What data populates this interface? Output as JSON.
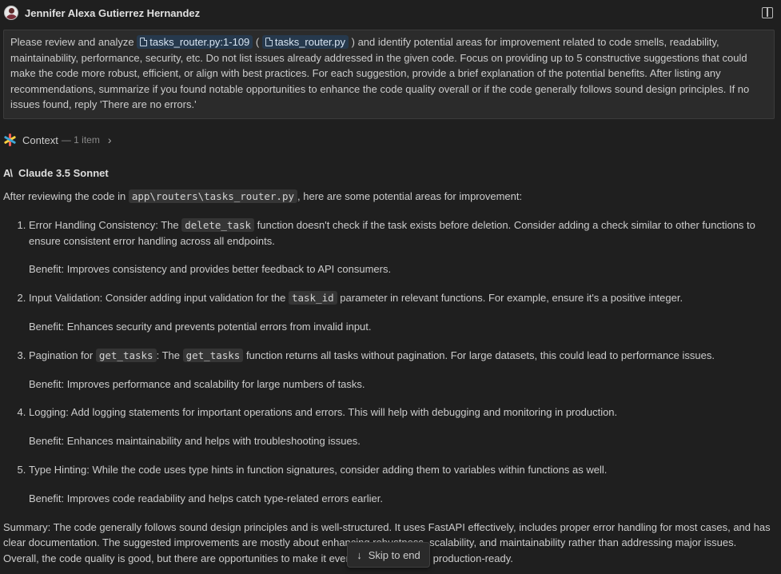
{
  "header": {
    "username": "Jennifer Alexa Gutierrez Hernandez"
  },
  "prompt": {
    "text_before": "Please review and analyze ",
    "chip1": "tasks_router.py:1-109",
    "text_mid1": " ( ",
    "chip2": "tasks_router.py",
    "text_after": " ) and identify potential areas for improvement related to code smells, readability, maintainability, performance, security, etc. Do not list issues already addressed in the given code. Focus on providing up to 5 constructive suggestions that could make the code more robust, efficient, or align with best practices. For each suggestion, provide a brief explanation of the potential benefits. After listing any recommendations, summarize if you found notable opportunities to enhance the code quality overall or if the code generally follows sound design principles. If no issues found, reply 'There are no errors.'"
  },
  "context": {
    "label": "Context",
    "count": "— 1 item"
  },
  "model": {
    "icon_text": "A\\",
    "name": "Claude 3.5 Sonnet"
  },
  "response": {
    "intro_before": "After reviewing the code in ",
    "intro_code": "app\\routers\\tasks_router.py",
    "intro_after": ", here are some potential areas for improvement:",
    "items": [
      {
        "a": "Error Handling Consistency: The ",
        "code": "delete_task",
        "b": " function doesn't check if the task exists before deletion. Consider adding a check similar to other functions to ensure consistent error handling across all endpoints.",
        "benefit": "Benefit: Improves consistency and provides better feedback to API consumers."
      },
      {
        "a": "Input Validation: Consider adding input validation for the ",
        "code": "task_id",
        "b": " parameter in relevant functions. For example, ensure it's a positive integer.",
        "benefit": "Benefit: Enhances security and prevents potential errors from invalid input."
      },
      {
        "a": "Pagination for ",
        "code": "get_tasks",
        "mid": ": The ",
        "code2": "get_tasks",
        "b": " function returns all tasks without pagination. For large datasets, this could lead to performance issues.",
        "benefit": "Benefit: Improves performance and scalability for large numbers of tasks."
      },
      {
        "a": "Logging: Add logging statements for important operations and errors. This will help with debugging and monitoring in production.",
        "benefit": "Benefit: Enhances maintainability and helps with troubleshooting issues."
      },
      {
        "a": "Type Hinting: While the code uses type hints in function signatures, consider adding them to variables within functions as well.",
        "benefit": "Benefit: Improves code readability and helps catch type-related errors earlier."
      }
    ],
    "summary": "Summary: The code generally follows sound design principles and is well-structured. It uses FastAPI effectively, includes proper error handling for most cases, and has clear documentation. The suggested improvements are mostly about enhancing robustness, scalability, and maintainability rather than addressing major issues. Overall, the code quality is good, but there are opportunities to make it even more robust and production-ready."
  },
  "skip": {
    "label": "Skip to end"
  }
}
